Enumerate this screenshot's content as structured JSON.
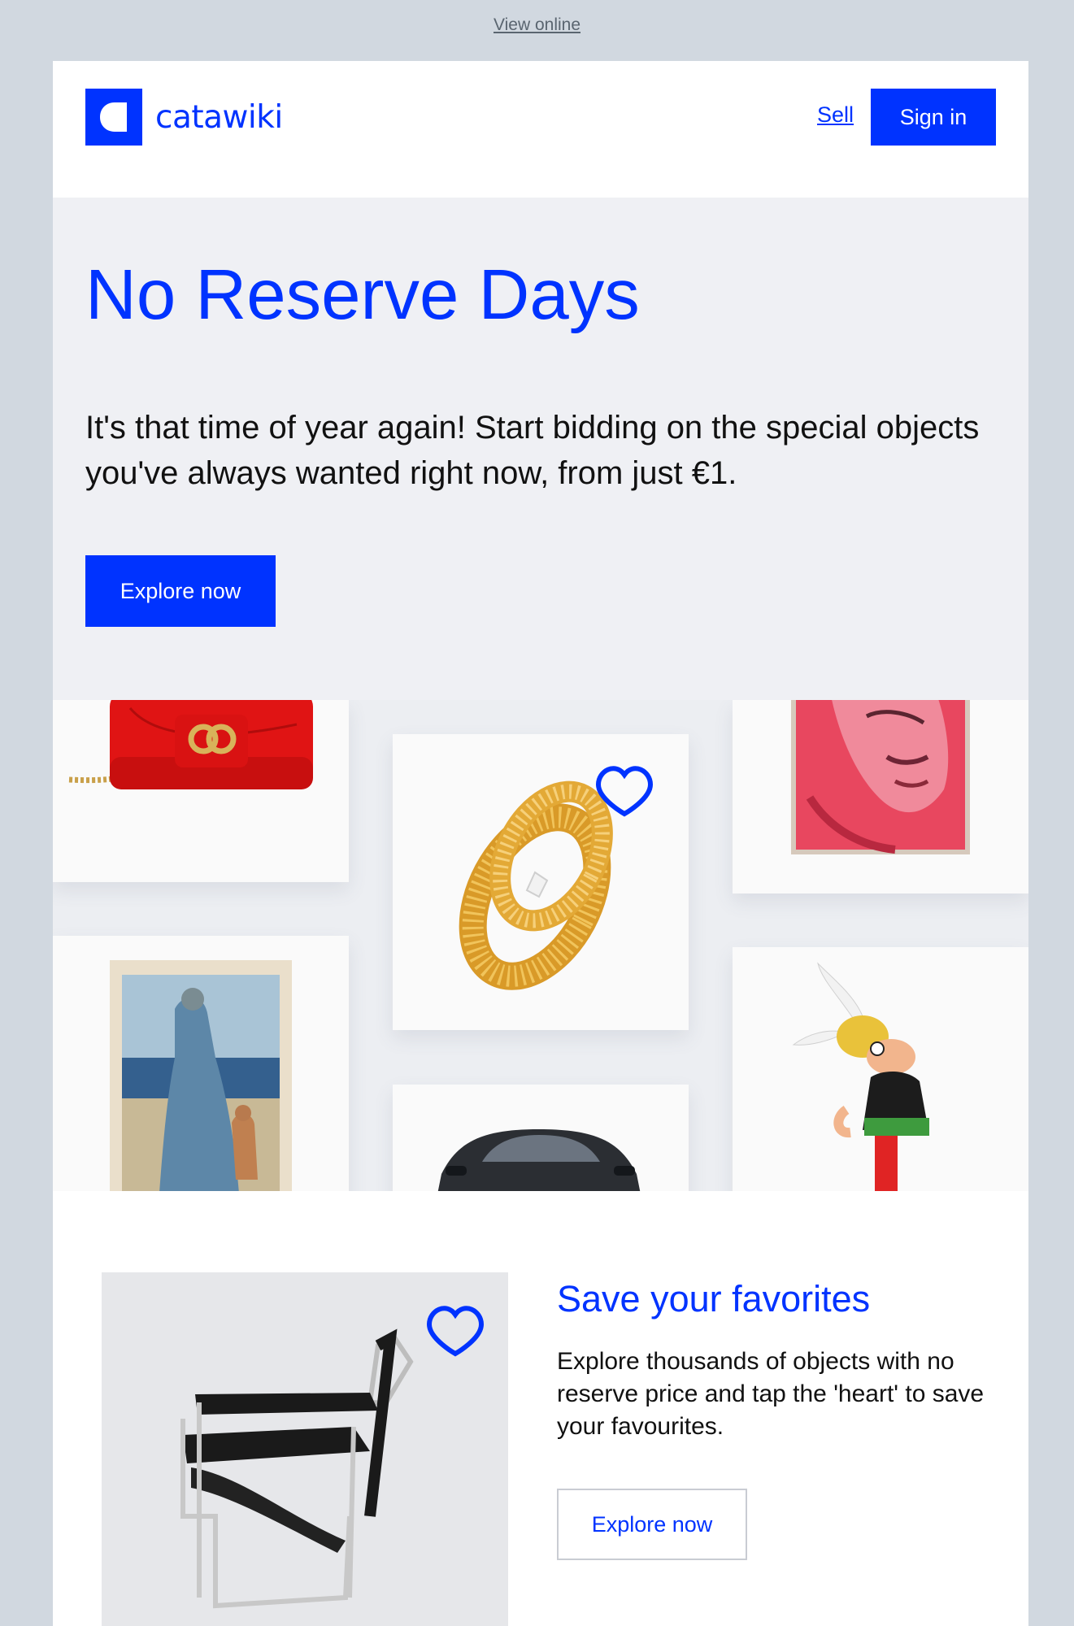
{
  "topbar": {
    "view_online": "View online"
  },
  "header": {
    "logo_text": "catawiki",
    "sell_label": "Sell",
    "signin_label": "Sign in"
  },
  "hero": {
    "title": "No Reserve Days",
    "text": "It's that time of year again! Start bidding on the special objects you've always wanted right now, from just €1.",
    "button_label": "Explore now"
  },
  "collage": {
    "items": [
      "red-handbag",
      "gold-ring",
      "portrait-painting",
      "picasso-print",
      "sports-car",
      "asterix-figure"
    ]
  },
  "favorites": {
    "title": "Save your favorites",
    "text": "Explore thousands of objects with no reserve price and tap the 'heart' to save your favourites.",
    "button_label": "Explore now"
  },
  "colors": {
    "brand": "#0033ff",
    "page_bg": "#d1d8e0",
    "hero_bg": "#eff0f4"
  }
}
